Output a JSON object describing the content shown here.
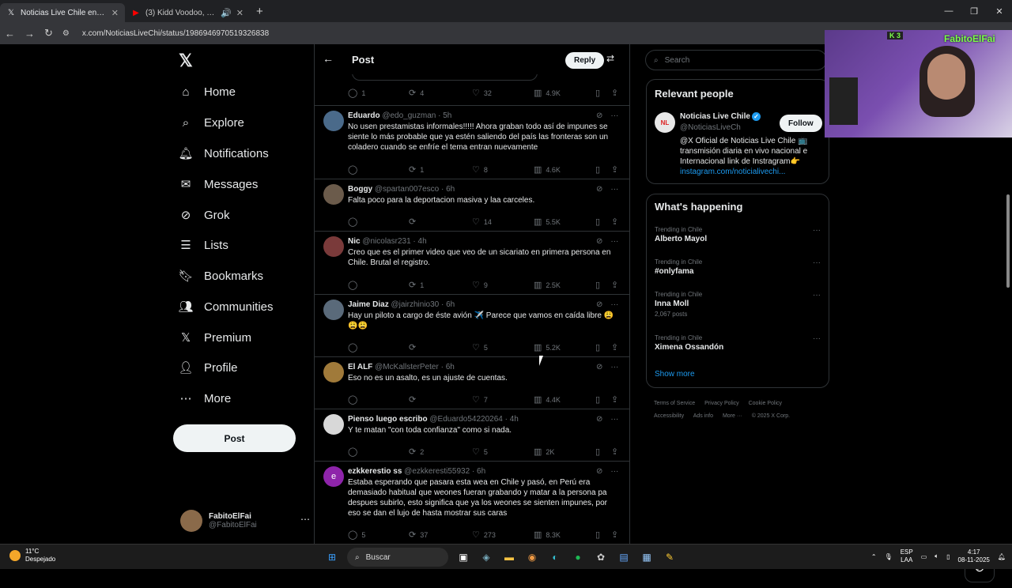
{
  "browser": {
    "tabs": [
      {
        "title": "Noticias Live Chile en X: \"#con",
        "active": true
      },
      {
        "title": "(3) Kidd Voodoo, Ñengo Fl",
        "active": false
      }
    ],
    "url": "x.com/NoticiasLiveChi/status/1986946970519326838"
  },
  "nav": {
    "items": [
      {
        "label": "Home",
        "icon": "home-icon"
      },
      {
        "label": "Explore",
        "icon": "search-icon"
      },
      {
        "label": "Notifications",
        "icon": "bell-icon"
      },
      {
        "label": "Messages",
        "icon": "mail-icon"
      },
      {
        "label": "Grok",
        "icon": "grok-icon"
      },
      {
        "label": "Lists",
        "icon": "list-icon"
      },
      {
        "label": "Bookmarks",
        "icon": "bookmark-icon"
      },
      {
        "label": "Communities",
        "icon": "people-icon"
      },
      {
        "label": "Premium",
        "icon": "x-icon"
      },
      {
        "label": "Profile",
        "icon": "person-icon"
      },
      {
        "label": "More",
        "icon": "more-icon"
      }
    ],
    "post_label": "Post",
    "account": {
      "name": "FabitoElFai",
      "handle": "@FabitoElFai"
    }
  },
  "post_header": {
    "title": "Post",
    "reply_label": "Reply"
  },
  "top_actions": {
    "replies": "1",
    "reposts": "4",
    "likes": "32",
    "views": "4.9K"
  },
  "tweets": [
    {
      "name": "Eduardo",
      "handle": "@edo_guzman",
      "time": "· 5h",
      "text": "No usen prestamistas informales!!!!! Ahora graban todo así de impunes se siente lo más probable que ya estén saliendo del país las fronteras son un coladero cuando se enfríe el tema entran nuevamente",
      "replies": "",
      "reposts": "1",
      "likes": "8",
      "views": "4.6K",
      "avatar_color": "#4a6a8a"
    },
    {
      "name": "Boggy",
      "handle": "@spartan007esco",
      "time": "· 6h",
      "text": "Falta poco para la deportacion masiva y laa carceles.",
      "replies": "",
      "reposts": "",
      "likes": "14",
      "views": "5.5K",
      "avatar_color": "#6b5b4b"
    },
    {
      "name": "Nic",
      "handle": "@nicolasr231",
      "time": "· 4h",
      "text": "Creo que es el primer video que veo de un sicariato en primera persona en Chile. Brutal el registro.",
      "replies": "",
      "reposts": "1",
      "likes": "9",
      "views": "2.5K",
      "avatar_color": "#7a3a3a"
    },
    {
      "name": "Jaime Diaz",
      "handle": "@jairzhinio30",
      "time": "· 6h",
      "text": "Hay un piloto a cargo de éste avión ✈️ Parece que vamos en caída libre 😩😩😩",
      "replies": "",
      "reposts": "",
      "likes": "5",
      "views": "5.2K",
      "avatar_color": "#5a6a7a"
    },
    {
      "name": "El ALF",
      "handle": "@McKallsterPeter",
      "time": "· 6h",
      "text": "Eso no es un asalto, es un ajuste de cuentas.",
      "replies": "",
      "reposts": "",
      "likes": "7",
      "views": "4.4K",
      "avatar_color": "#a07a3a"
    },
    {
      "name": "Pienso luego escribo",
      "handle": "@Eduardo54220264",
      "time": "· 4h",
      "text": "Y te matan \"con toda confianza\" como si nada.",
      "replies": "",
      "reposts": "2",
      "likes": "5",
      "views": "2K",
      "avatar_color": "#d8d8d8"
    },
    {
      "name": "ezkkerestio ss",
      "handle": "@ezkkeresti55932",
      "time": "· 6h",
      "text": "Estaba esperando que pasara esta wea en Chile y pasó, en Perú era demasiado habitual que weones fueran grabando y matar a la persona pa despues subirlo, esto significa que ya los weones se sienten impunes, por eso se dan el lujo de hasta mostrar sus caras",
      "replies": "5",
      "reposts": "37",
      "likes": "273",
      "views": "8.3K",
      "avatar_color": "#8e24aa",
      "initial": "e"
    }
  ],
  "right": {
    "search_placeholder": "Search",
    "relevant_title": "Relevant people",
    "person": {
      "name": "Noticias Live Chile",
      "handle": "@NoticiasLiveCh",
      "follow_label": "Follow",
      "bio": "@X Oficial de Noticias Live Chile 📺 transmisión diaria en vivo nacional e Internacional link de Instragram👉",
      "bio_link": "instagram.com/noticialivechi..."
    },
    "happening_title": "What's happening",
    "trends": [
      {
        "context": "Trending in Chile",
        "name": "Alberto Mayol",
        "count": ""
      },
      {
        "context": "Trending in Chile",
        "name": "#onlyfama",
        "count": ""
      },
      {
        "context": "Trending in Chile",
        "name": "Inna Moll",
        "count": "2,067 posts"
      },
      {
        "context": "Trending in Chile",
        "name": "Ximena Ossandón",
        "count": ""
      }
    ],
    "show_more": "Show more",
    "footer": [
      "Terms of Service",
      "Privacy Policy",
      "Cookie Policy",
      "Accessibility",
      "Ads info",
      "More ···",
      "© 2025 X Corp."
    ]
  },
  "stream": {
    "name": "FabitoElFai",
    "tag": "K 3"
  },
  "taskbar": {
    "weather_temp": "11°C",
    "weather_desc": "Despejado",
    "search_label": "Buscar",
    "lang": "ESP",
    "lang2": "LAA",
    "time": "4:17",
    "date": "08-11-2025"
  }
}
